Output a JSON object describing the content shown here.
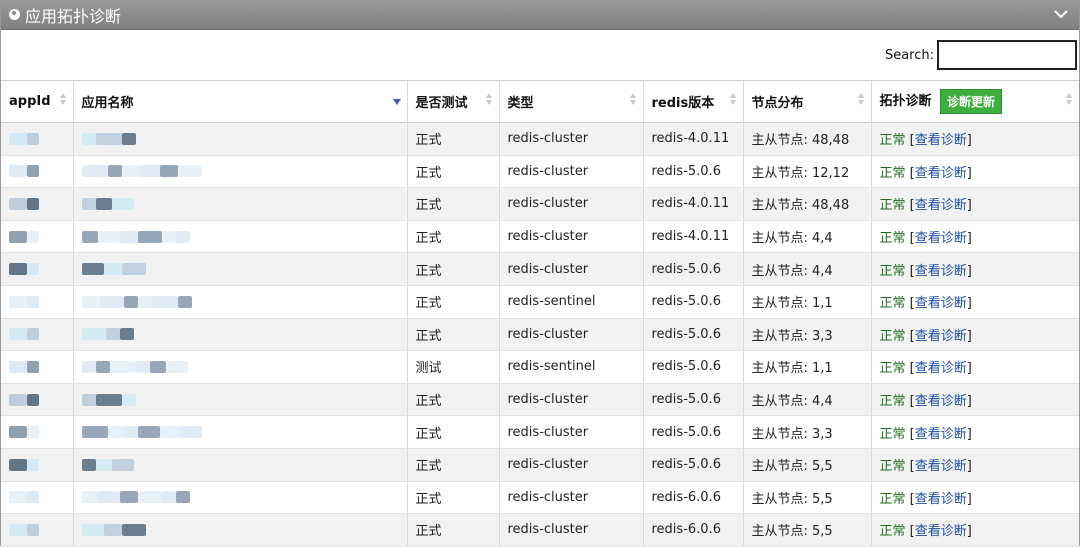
{
  "panel": {
    "title": "应用拓扑诊断"
  },
  "search": {
    "label": "Search:",
    "value": "",
    "placeholder": ""
  },
  "table": {
    "headers": {
      "appid": "appId",
      "app_name": "应用名称",
      "is_test": "是否测试",
      "type": "类型",
      "redis_version": "redis版本",
      "nodes": "节点分布",
      "diagnosis": "拓扑诊断",
      "refresh_button": "诊断更新"
    },
    "rows": [
      {
        "is_test": "正式",
        "type": "redis-cluster",
        "version": "redis-4.0.11",
        "nodes": "主从节点: 48,48",
        "status": "正常",
        "bracket_open": "[",
        "link": "查看诊断",
        "bracket_close": "]"
      },
      {
        "is_test": "正式",
        "type": "redis-cluster",
        "version": "redis-5.0.6",
        "nodes": "主从节点: 12,12",
        "status": "正常",
        "bracket_open": "[",
        "link": "查看诊断",
        "bracket_close": "]"
      },
      {
        "is_test": "正式",
        "type": "redis-cluster",
        "version": "redis-4.0.11",
        "nodes": "主从节点: 48,48",
        "status": "正常",
        "bracket_open": "[",
        "link": "查看诊断",
        "bracket_close": "]"
      },
      {
        "is_test": "正式",
        "type": "redis-cluster",
        "version": "redis-4.0.11",
        "nodes": "主从节点: 4,4",
        "status": "正常",
        "bracket_open": "[",
        "link": "查看诊断",
        "bracket_close": "]"
      },
      {
        "is_test": "正式",
        "type": "redis-cluster",
        "version": "redis-5.0.6",
        "nodes": "主从节点: 4,4",
        "status": "正常",
        "bracket_open": "[",
        "link": "查看诊断",
        "bracket_close": "]"
      },
      {
        "is_test": "正式",
        "type": "redis-sentinel",
        "version": "redis-5.0.6",
        "nodes": "主从节点: 1,1",
        "status": "正常",
        "bracket_open": "[",
        "link": "查看诊断",
        "bracket_close": "]"
      },
      {
        "is_test": "正式",
        "type": "redis-cluster",
        "version": "redis-5.0.6",
        "nodes": "主从节点: 3,3",
        "status": "正常",
        "bracket_open": "[",
        "link": "查看诊断",
        "bracket_close": "]"
      },
      {
        "is_test": "测试",
        "type": "redis-sentinel",
        "version": "redis-5.0.6",
        "nodes": "主从节点: 1,1",
        "status": "正常",
        "bracket_open": "[",
        "link": "查看诊断",
        "bracket_close": "]"
      },
      {
        "is_test": "正式",
        "type": "redis-cluster",
        "version": "redis-5.0.6",
        "nodes": "主从节点: 4,4",
        "status": "正常",
        "bracket_open": "[",
        "link": "查看诊断",
        "bracket_close": "]"
      },
      {
        "is_test": "正式",
        "type": "redis-cluster",
        "version": "redis-5.0.6",
        "nodes": "主从节点: 3,3",
        "status": "正常",
        "bracket_open": "[",
        "link": "查看诊断",
        "bracket_close": "]"
      },
      {
        "is_test": "正式",
        "type": "redis-cluster",
        "version": "redis-5.0.6",
        "nodes": "主从节点: 5,5",
        "status": "正常",
        "bracket_open": "[",
        "link": "查看诊断",
        "bracket_close": "]"
      },
      {
        "is_test": "正式",
        "type": "redis-cluster",
        "version": "redis-6.0.6",
        "nodes": "主从节点: 5,5",
        "status": "正常",
        "bracket_open": "[",
        "link": "查看诊断",
        "bracket_close": "]"
      },
      {
        "is_test": "正式",
        "type": "redis-cluster",
        "version": "redis-6.0.6",
        "nodes": "主从节点: 5,5",
        "status": "正常",
        "bracket_open": "[",
        "link": "查看诊断",
        "bracket_close": "]"
      }
    ]
  },
  "colors": {
    "header_bg": "#8c8c8c",
    "status_ok": "#1f6e1f",
    "link": "#1f4e9e",
    "refresh_button": "#3eae3e",
    "sort_desc": "#4658c9",
    "redacted_dark": "#4a5f74",
    "redacted_light": "#cfe9f5"
  },
  "icons": {
    "header": "globe-icon",
    "collapse": "chevron-down-icon",
    "sort": "sort-both-icon",
    "sort_active": "sort-desc-icon"
  }
}
